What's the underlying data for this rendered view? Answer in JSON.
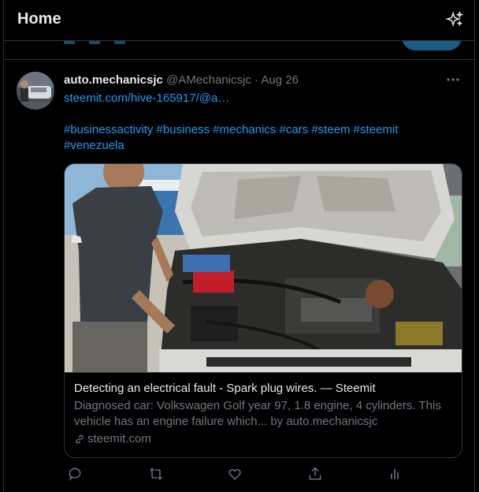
{
  "header": {
    "title": "Home",
    "sparkle_icon": "sparkle-icon"
  },
  "tweet": {
    "display_name": "auto.mechanicsjc",
    "handle": "@AMechanicsjc",
    "separator": "·",
    "date": "Aug 26",
    "link_text": "steemit.com/hive-165917/@a…",
    "hashtags": "#businessactivity #business #mechanics #cars #steem #steemit #venezuela",
    "card": {
      "title": "Detecting an electrical fault - Spark plug wires. — Steemit",
      "description": "Diagnosed car: Volkswagen Golf year 97, 1.8 engine, 4 cylinders. This vehicle has an engine failure which... by auto.mechanicsjc",
      "domain": "steemit.com"
    },
    "actions": [
      "reply-icon",
      "retweet-icon",
      "like-icon",
      "share-icon",
      "analytics-icon"
    ]
  },
  "colors": {
    "background": "#000000",
    "text": "#e7e9ea",
    "muted": "#71767b",
    "link": "#1d9bf0",
    "border": "#2f3336"
  }
}
